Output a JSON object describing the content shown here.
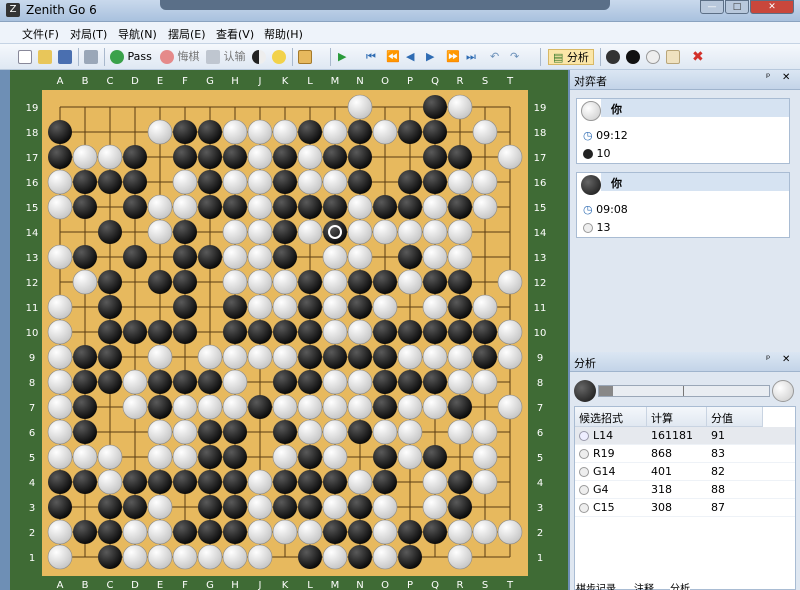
{
  "window": {
    "title": "Zenith Go 6",
    "logo": "Z"
  },
  "window_controls": {
    "minimize": "—",
    "maximize": "□",
    "close": "✕"
  },
  "menu": [
    "文件(F)",
    "对局(T)",
    "导航(N)",
    "摆局(E)",
    "查看(V)",
    "帮助(H)"
  ],
  "toolbar": {
    "pass": "Pass",
    "undo": "悔棋",
    "resign": "认输",
    "analysis": "分析"
  },
  "icons": [
    "new-icon",
    "open-icon",
    "save-icon",
    "print-icon",
    "pass-icon",
    "undo-icon",
    "resign-icon",
    "score-icon",
    "hint-icon",
    "board-icon",
    "play-icon",
    "first-icon",
    "prev10-icon",
    "prev-icon",
    "next-icon",
    "next10-icon",
    "last-icon",
    "variation-icon",
    "analysis-icon",
    "stones-icon",
    "delete-icon"
  ],
  "board": {
    "size": 19,
    "columns": [
      "A",
      "B",
      "C",
      "D",
      "E",
      "F",
      "G",
      "H",
      "J",
      "K",
      "L",
      "M",
      "N",
      "O",
      "P",
      "Q",
      "R",
      "S",
      "T"
    ],
    "rows": [
      "19",
      "18",
      "17",
      "16",
      "15",
      "14",
      "13",
      "12",
      "11",
      "10",
      "9",
      "8",
      "7",
      "6",
      "5",
      "4",
      "3",
      "2",
      "1"
    ],
    "grid": [
      "............W..BW..",
      "B...WBBWWWBWBWBB.W.",
      "BWWB.BBBWBWBB..BB.W",
      "WBBB.WBWWBWWB.BBWW.",
      "WB.BWWBBWBBBWBBWBW.",
      "..B.WB.WWBWBWWWWW..",
      "WB.B.BBWWB.WW.BWW..",
      ".WB.BB.WWWBWBBWBB.W",
      "W.B..B.BWWBWBW.WBW.",
      "W.BBBB.BBBBWWBBBBBW",
      "WBB.W.WWWWBBBBWWWBW",
      "WBBWBBBW.BBWWBBBWW.",
      "WB.WBWWWBWWWWBWWB.W",
      "WB..WWBB.BWWBWW.WW.",
      "WWW.WWBB.WBW.BWB.W.",
      "BBWBBBBBWBBBWB.WBW.",
      "B.BBW.BBWBBWBW.WB..",
      "WBBWWBBBWWWBBWBBWWW",
      "W.BWWWWWW.BWBWB.W.."
    ],
    "last_move": "M14"
  },
  "players_panel": {
    "title": "对弈者",
    "players": [
      {
        "color": "white",
        "name": "你",
        "time": "09:12",
        "captures": "10"
      },
      {
        "color": "black",
        "name": "你",
        "time": "09:08",
        "captures": "13"
      }
    ]
  },
  "analysis_panel": {
    "title": "分析",
    "columns": [
      "候选招式",
      "计算",
      "分值"
    ],
    "rows": [
      {
        "move": "L14",
        "calc": "161181",
        "score": "91"
      },
      {
        "move": "R19",
        "calc": "868",
        "score": "83"
      },
      {
        "move": "G14",
        "calc": "401",
        "score": "82"
      },
      {
        "move": "G4",
        "calc": "318",
        "score": "88"
      },
      {
        "move": "C15",
        "calc": "308",
        "score": "87"
      }
    ]
  },
  "bottom_tabs": [
    "棋步记录",
    "注释",
    "分析"
  ],
  "panel_controls": {
    "pin": "ᵖ",
    "close": "✕"
  },
  "colors": {
    "board": "#e7b95e",
    "felt": "#3f6b35",
    "line": "#5a3c12",
    "accent": "#2f6cb3"
  }
}
